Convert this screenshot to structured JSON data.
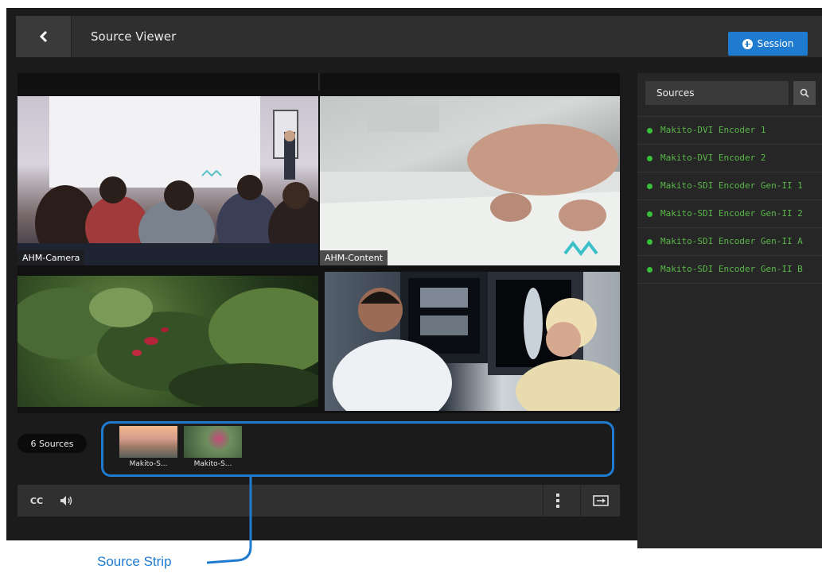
{
  "caption": "",
  "header": {
    "title": "Source Viewer",
    "session_button": "Session"
  },
  "tiles": [
    {
      "label": "AHM-Camera"
    },
    {
      "label": "AHM-Content"
    },
    {
      "label": ""
    },
    {
      "label": ""
    }
  ],
  "sources_panel": {
    "search_label": "Sources",
    "items": [
      "Makito-DVI Encoder 1",
      "Makito-DVI Encoder 2",
      "Makito-SDI Encoder Gen-II 1",
      "Makito-SDI Encoder Gen-II 2",
      "Makito-SDI Encoder Gen-II A",
      "Makito-SDI Encoder Gen-II B"
    ]
  },
  "strip": {
    "count_label": "6 Sources",
    "thumbs": [
      {
        "label": "Makito-S..."
      },
      {
        "label": "Makito-S..."
      }
    ]
  },
  "controls": {
    "cc_label": "CC"
  },
  "annotation": {
    "label": "Source Strip",
    "color": "#1e7bd0"
  },
  "colors": {
    "accent": "#1e7bd0",
    "source_green": "#5ab64a",
    "status_dot": "#39c03a"
  }
}
